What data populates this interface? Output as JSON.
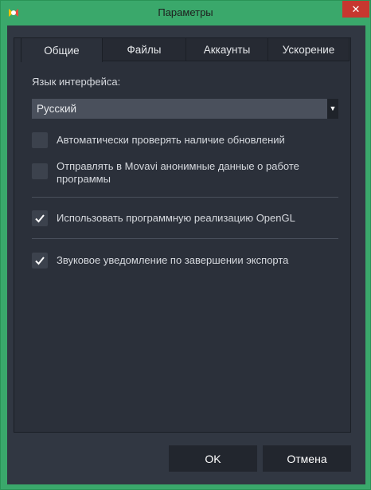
{
  "window": {
    "title": "Параметры",
    "close_glyph": "✕",
    "icon": "movavi-logo-icon"
  },
  "tabs": [
    {
      "label": "Общие",
      "active": true
    },
    {
      "label": "Файлы",
      "active": false
    },
    {
      "label": "Аккаунты",
      "active": false
    },
    {
      "label": "Ускорение",
      "active": false
    }
  ],
  "general": {
    "language_label": "Язык интерфейса:",
    "language_value": "Русский",
    "options": [
      {
        "label": "Автоматически проверять наличие обновлений",
        "checked": false
      },
      {
        "label": "Отправлять в Movavi анонимные данные о работе программы",
        "checked": false
      },
      {
        "label": "Использовать программную реализацию OpenGL",
        "checked": true
      },
      {
        "label": "Звуковое уведомление по завершении экспорта",
        "checked": true
      }
    ]
  },
  "buttons": {
    "ok": "OK",
    "cancel": "Отмена"
  },
  "colors": {
    "titlebar": "#3aa86b",
    "background": "#313742",
    "panel": "#2b303a",
    "close": "#c7372f"
  }
}
